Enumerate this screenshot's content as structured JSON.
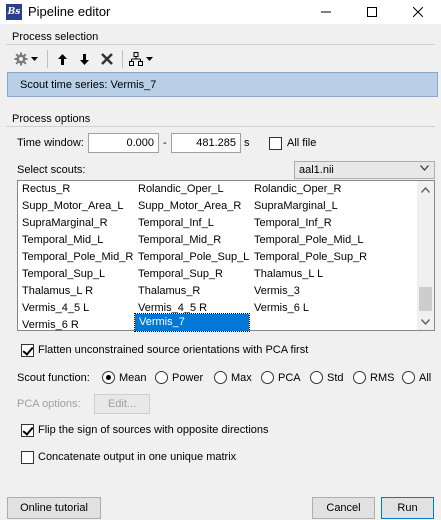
{
  "window": {
    "app_icon_text": "Bs",
    "title": "Pipeline editor"
  },
  "process_selection": {
    "label": "Process selection",
    "toolbar": [
      "gear-dropdown",
      "move-up",
      "move-down",
      "delete",
      "pipeline-dropdown"
    ],
    "selected_process": "Scout time series: Vermis_7"
  },
  "process_options": {
    "label": "Process options",
    "time_window": {
      "label": "Time window:",
      "start": "0.000",
      "separator": "-",
      "end": "481.285",
      "unit": "s",
      "all_file_label": "All file",
      "all_file_checked": false
    },
    "select_scouts": {
      "label": "Select scouts:",
      "atlas": "aal1.nii",
      "columns": [
        [
          "Rectus_R",
          "Supp_Motor_Area_L",
          "SupraMarginal_R",
          "Temporal_Mid_L",
          "Temporal_Pole_Mid_R",
          "Temporal_Sup_L",
          "Thalamus_L R",
          "Vermis_4_5 L",
          "Vermis_6 R"
        ],
        [
          "Rolandic_Oper_L",
          "Supp_Motor_Area_R",
          "Temporal_Inf_L",
          "Temporal_Mid_R",
          "Temporal_Pole_Sup_L",
          "Temporal_Sup_R",
          "Thalamus_R",
          "Vermis_4_5 R",
          "Vermis_7"
        ],
        [
          "Rolandic_Oper_R",
          "SupraMarginal_L",
          "Temporal_Inf_R",
          "Temporal_Pole_Mid_L",
          "Temporal_Pole_Sup_R",
          "Thalamus_L L",
          "Vermis_3",
          "Vermis_6 L",
          ""
        ]
      ],
      "selected": "Vermis_7"
    },
    "flatten": {
      "label": "Flatten unconstrained source orientations with PCA first",
      "checked": true
    },
    "scout_function": {
      "label": "Scout function:",
      "options": [
        "Mean",
        "Power",
        "Max",
        "PCA",
        "Std",
        "RMS",
        "All"
      ],
      "selected": "Mean"
    },
    "pca_options": {
      "label": "PCA options:",
      "button": "Edit..."
    },
    "flip_sign": {
      "label": "Flip the sign of sources with opposite directions",
      "checked": true
    },
    "concatenate": {
      "label": "Concatenate output in one unique matrix",
      "checked": false
    }
  },
  "footer": {
    "online_tutorial": "Online tutorial",
    "cancel": "Cancel",
    "run": "Run"
  }
}
